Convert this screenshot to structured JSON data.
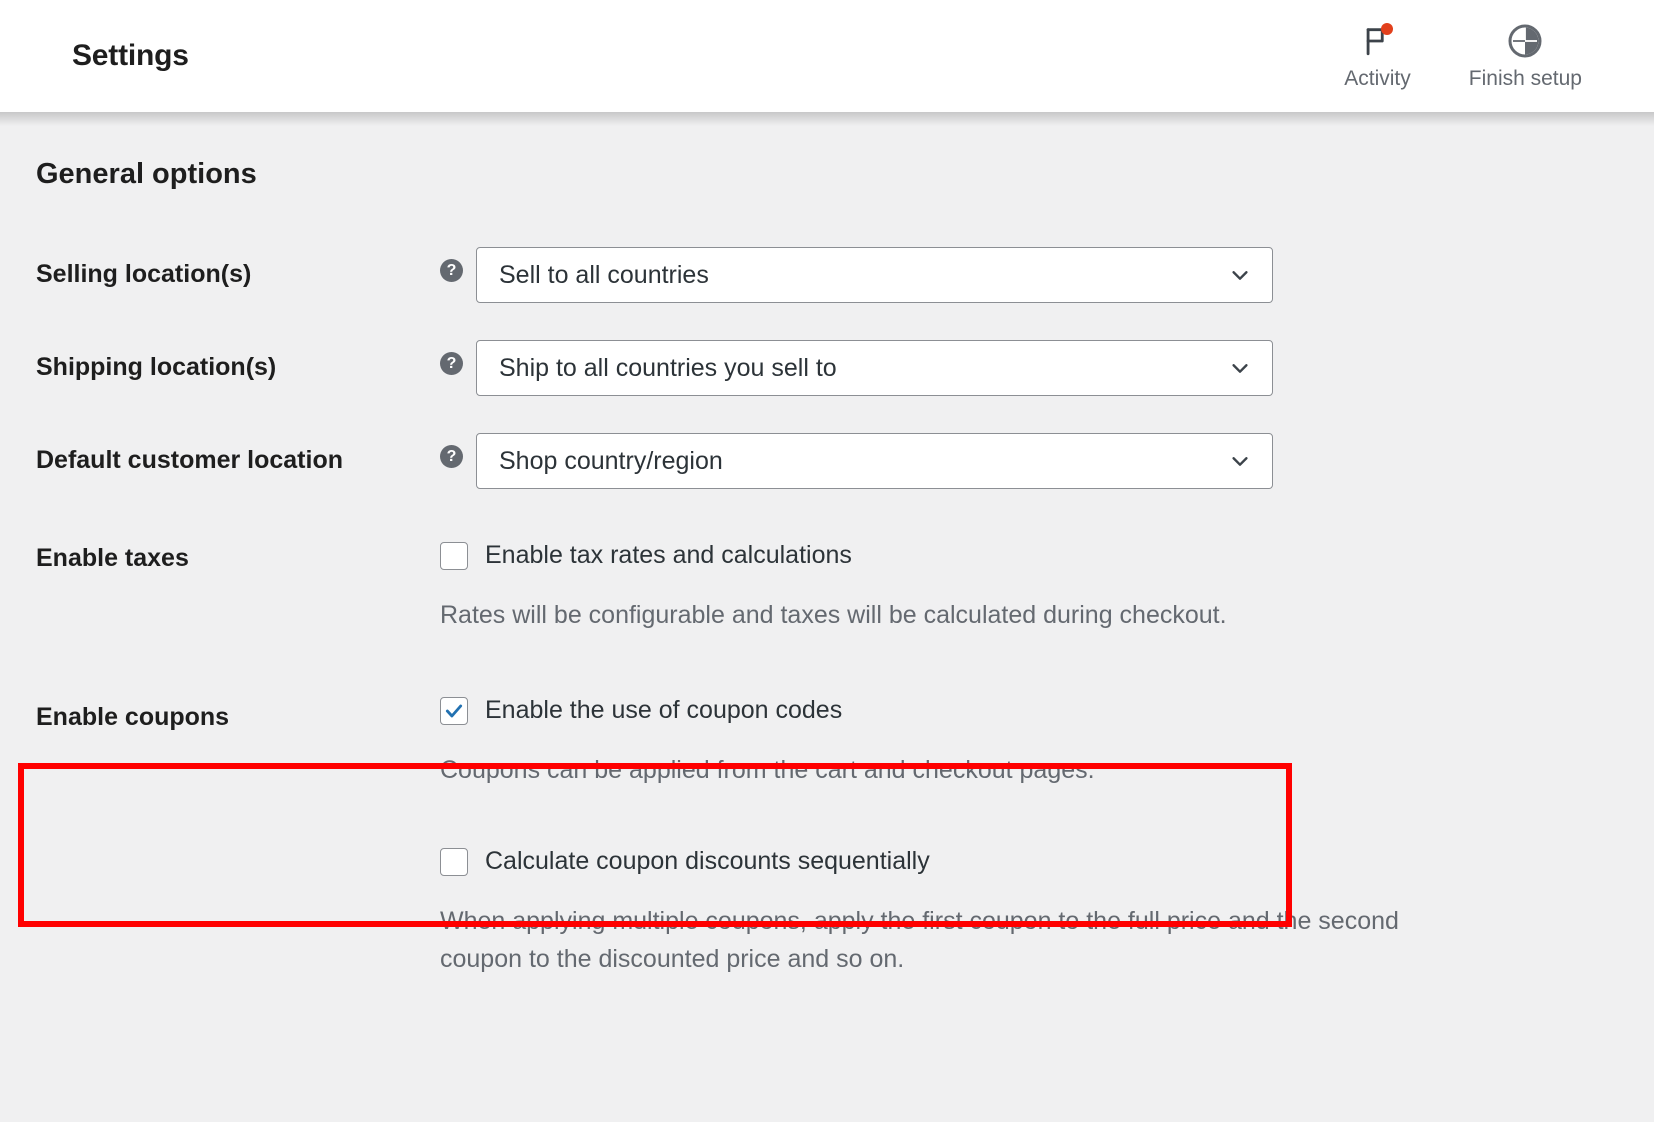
{
  "header": {
    "title": "Settings",
    "actions": [
      {
        "label": "Activity",
        "icon": "flag-icon",
        "has_notification": true
      },
      {
        "label": "Finish setup",
        "icon": "progress-circle-icon",
        "has_notification": false
      }
    ]
  },
  "main": {
    "section_title": "General options",
    "rows": [
      {
        "label": "Selling location(s)",
        "type": "select",
        "help": "?",
        "value": "Sell to all countries"
      },
      {
        "label": "Shipping location(s)",
        "type": "select",
        "help": "?",
        "value": "Ship to all countries you sell to"
      },
      {
        "label": "Default customer location",
        "type": "select",
        "help": "?",
        "value": "Shop country/region"
      },
      {
        "label": "Enable taxes",
        "type": "checkbox",
        "checkbox_label": "Enable tax rates and calculations",
        "checked": false,
        "description": "Rates will be configurable and taxes will be calculated during checkout."
      },
      {
        "label": "Enable coupons",
        "type": "checkbox",
        "checkbox_label": "Enable the use of coupon codes",
        "checked": true,
        "description": "Coupons can be applied from the cart and checkout pages.",
        "highlighted": true
      },
      {
        "label": "",
        "type": "checkbox",
        "checkbox_label": "Calculate coupon discounts sequentially",
        "checked": false,
        "description": "When applying multiple coupons, apply the first coupon to the full price and the second coupon to the discounted price and so on."
      }
    ]
  },
  "colors": {
    "background": "#f0f0f1",
    "header_background": "#ffffff",
    "text_primary": "#1e1e1e",
    "text_secondary": "#646970",
    "checkbox_accent": "#2271b1",
    "notification_dot": "#e2401c",
    "highlight_border": "#ff0000",
    "field_border": "#8c8f94"
  }
}
